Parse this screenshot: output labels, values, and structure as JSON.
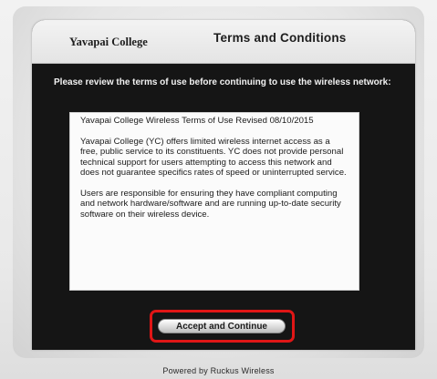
{
  "header": {
    "brand": "Yavapai College",
    "title": "Terms and Conditions"
  },
  "intro": "Please review the terms of use before continuing to use the wireless network:",
  "terms": {
    "heading": "Yavapai College Wireless Terms of Use  Revised 08/10/2015",
    "paragraph1": "Yavapai College (YC) offers limited wireless internet access as a free, public service to its constituents.  YC does not provide personal technical support for users attempting to access this network and does not guarantee specifics rates of speed or uninterrupted service.",
    "paragraph2": "Users are responsible for ensuring they have compliant computing and network hardware/software and are running up-to-date security software on their wireless device."
  },
  "accept_label": "Accept and Continue",
  "footer": "Powered by Ruckus Wireless",
  "colors": {
    "panel_background": "#151515",
    "highlight_border": "#e01616"
  }
}
